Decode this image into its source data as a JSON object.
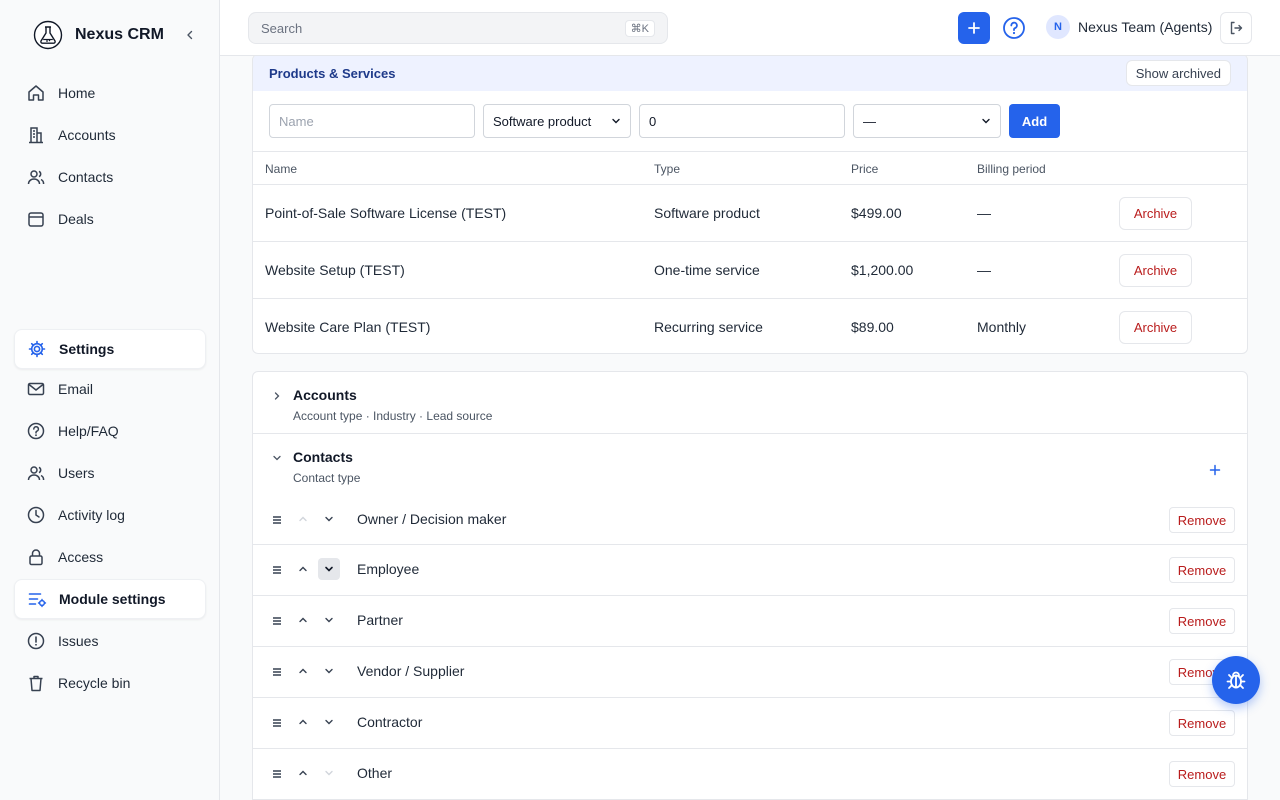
{
  "app": {
    "name": "Nexus CRM"
  },
  "sidebar": {
    "items": [
      {
        "label": "Home",
        "icon": "home-icon"
      },
      {
        "label": "Accounts",
        "icon": "building-icon"
      },
      {
        "label": "Contacts",
        "icon": "users-icon"
      },
      {
        "label": "Deals",
        "icon": "calendar-icon"
      },
      {
        "label": "Settings",
        "icon": "settings-icon",
        "active": true
      },
      {
        "label": "Email",
        "icon": "mail-icon"
      },
      {
        "label": "Help/FAQ",
        "icon": "help-icon"
      },
      {
        "label": "Users",
        "icon": "users-icon"
      },
      {
        "label": "Activity log",
        "icon": "clock-icon"
      },
      {
        "label": "Access",
        "icon": "lock-icon"
      },
      {
        "label": "Module settings",
        "icon": "sliders-icon",
        "active": true
      },
      {
        "label": "Issues",
        "icon": "alert-icon"
      },
      {
        "label": "Recycle bin",
        "icon": "trash-icon"
      }
    ]
  },
  "header": {
    "search_placeholder": "Search",
    "search_shortcut": "⌘K",
    "avatar_initial": "N",
    "user_name": "Nexus Team (Agents)"
  },
  "products": {
    "title": "Products & Services",
    "show_archived_label": "Show archived",
    "form": {
      "name_placeholder": "Name",
      "type_value": "Software product",
      "price_value": "0",
      "period_value": "—",
      "add_label": "Add"
    },
    "columns": [
      "Name",
      "Type",
      "Price",
      "Billing period"
    ],
    "rows": [
      {
        "name": "Point-of-Sale Software License (TEST)",
        "type": "Software product",
        "price": "$499.00",
        "period": "—",
        "action": "Archive"
      },
      {
        "name": "Website Setup (TEST)",
        "type": "One-time service",
        "price": "$1,200.00",
        "period": "—",
        "action": "Archive"
      },
      {
        "name": "Website Care Plan (TEST)",
        "type": "Recurring service",
        "price": "$89.00",
        "period": "Monthly",
        "action": "Archive"
      }
    ]
  },
  "sections": {
    "accounts": {
      "title": "Accounts",
      "subtitle": "Account type · Industry · Lead source"
    },
    "contacts": {
      "title": "Contacts",
      "subtitle": "Contact type",
      "options": [
        {
          "label": "Owner / Decision maker",
          "action": "Remove"
        },
        {
          "label": "Employee",
          "action": "Remove"
        },
        {
          "label": "Partner",
          "action": "Remove"
        },
        {
          "label": "Vendor / Supplier",
          "action": "Remove"
        },
        {
          "label": "Contractor",
          "action": "Remove"
        },
        {
          "label": "Other",
          "action": "Remove"
        }
      ]
    }
  },
  "colors": {
    "accent": "#2563eb",
    "danger": "#b91c1c",
    "header_tint": "#eef2ff"
  }
}
